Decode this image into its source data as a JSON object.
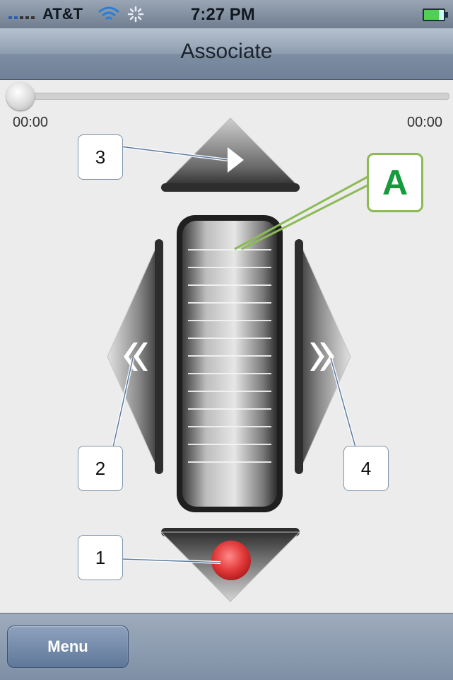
{
  "status_bar": {
    "carrier": "AT&T",
    "time": "7:27 PM"
  },
  "nav": {
    "title": "Associate"
  },
  "playback": {
    "progress": 0.0,
    "elapsed": "00:00",
    "duration": "00:00"
  },
  "callouts": {
    "one": "1",
    "two": "2",
    "three": "3",
    "four": "4",
    "a": "A"
  },
  "toolbar": {
    "menu_label": "Menu"
  },
  "icons": {
    "signal": "signal-bars-icon",
    "wifi": "wifi-icon",
    "activity": "activity-spinner-icon",
    "battery": "battery-icon",
    "play": "play-icon",
    "record": "record-icon",
    "rewind": "rewind-icon",
    "fast_forward": "fast-forward-icon",
    "jog_wheel": "jog-wheel-icon"
  },
  "colors": {
    "record": "#e33b3b",
    "callout_a_border": "#8cba55",
    "callout_a_text": "#149c3c",
    "callout_border": "#7d92a8"
  }
}
